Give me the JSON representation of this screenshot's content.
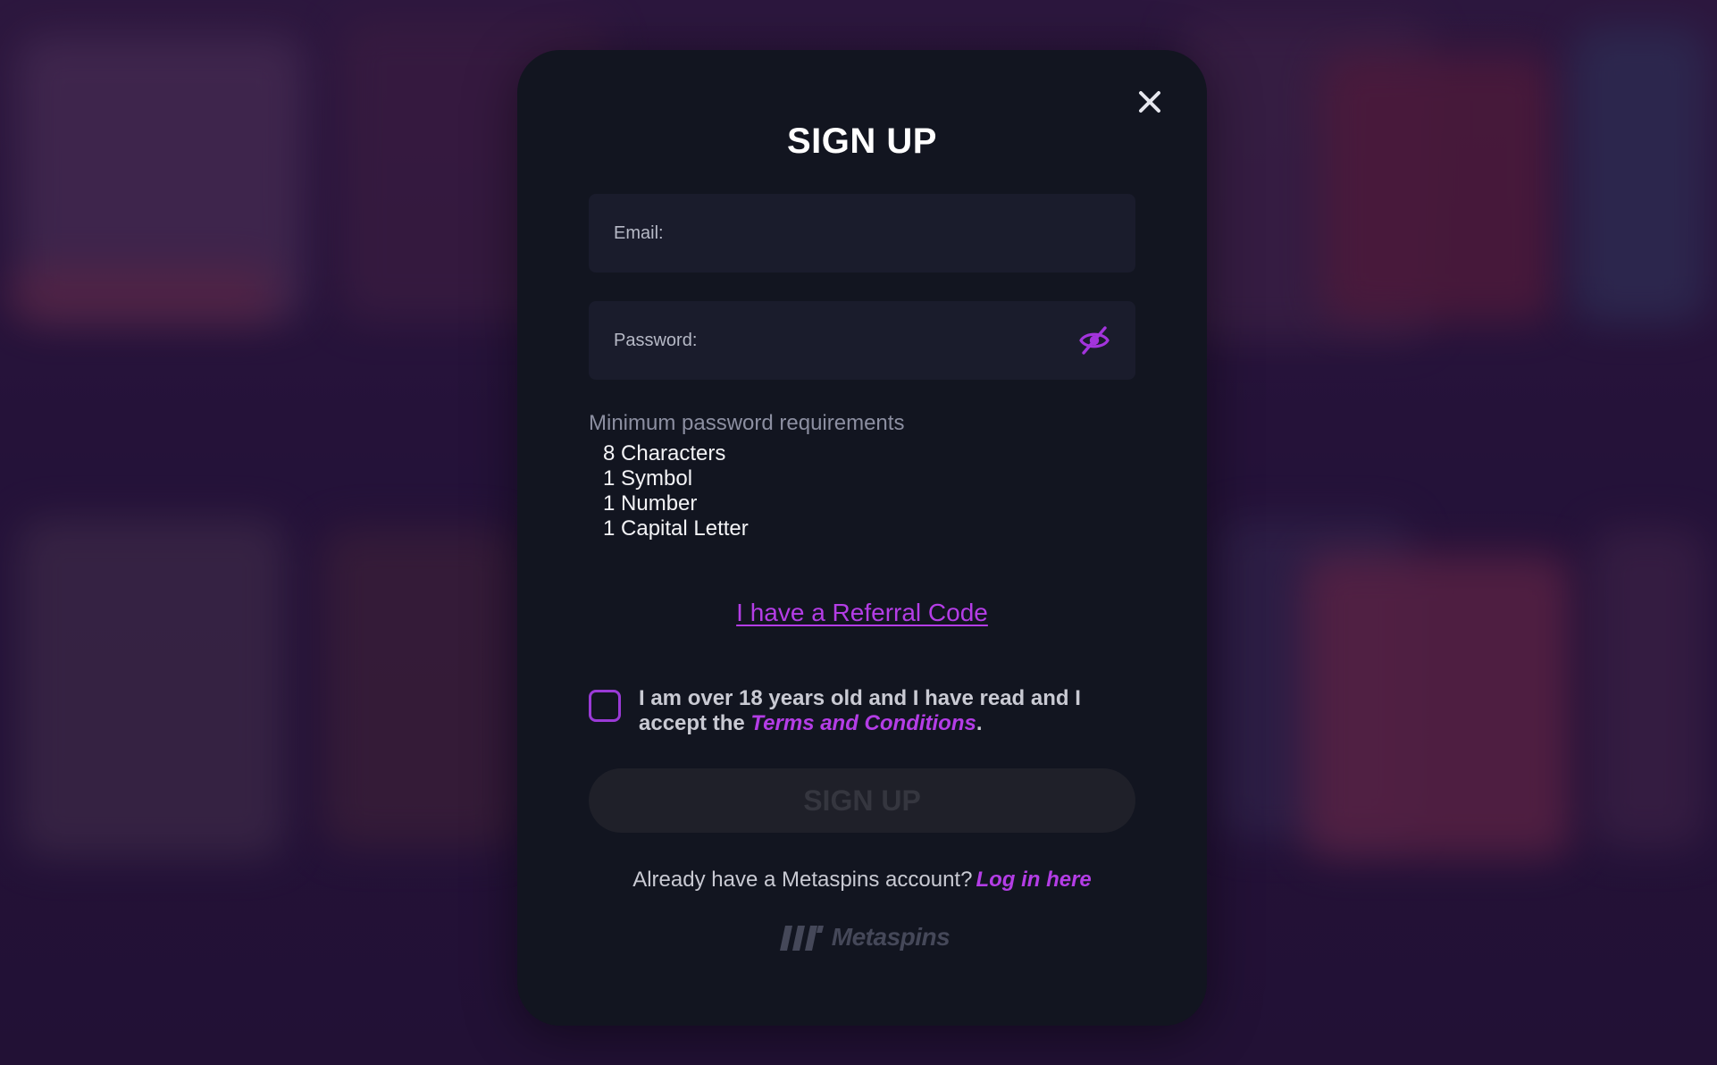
{
  "modal": {
    "title": "SIGN UP",
    "close_icon": "close-icon"
  },
  "form": {
    "email_label": "Email:",
    "password_label": "Password:",
    "password_toggle_icon": "eye-slash-icon"
  },
  "requirements": {
    "title": "Minimum password requirements",
    "items": [
      "8 Characters",
      "1 Symbol",
      "1 Number",
      "1 Capital Letter"
    ]
  },
  "referral": {
    "label": "I have a Referral Code"
  },
  "terms": {
    "text_before": "I am over 18 years old and I have read and I accept the ",
    "link": "Terms and Conditions",
    "text_after": ".",
    "checked": false
  },
  "signup_button": {
    "label": "SIGN UP",
    "enabled": false
  },
  "login": {
    "prompt": "Already have a Metaspins account?",
    "link": "Log in here"
  },
  "brand": {
    "name": "Metaspins"
  },
  "colors": {
    "accent": "#b43de6",
    "modal_bg": "#121520",
    "field_bg": "#1a1c2c",
    "disabled_button_bg": "#1f2029"
  }
}
